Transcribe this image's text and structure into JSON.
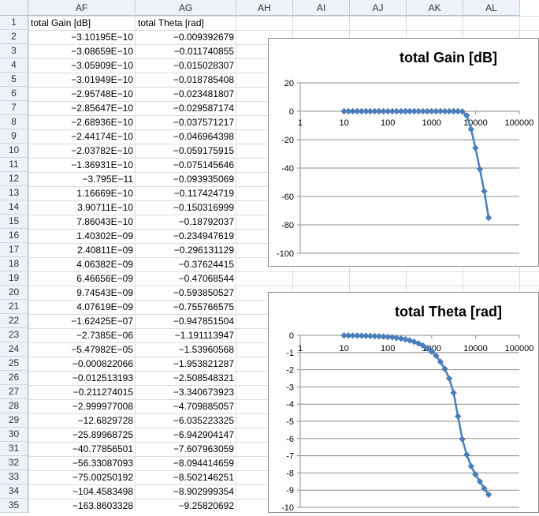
{
  "columns": [
    "AF",
    "AG",
    "AH",
    "AI",
    "AJ",
    "AK",
    "AL"
  ],
  "rows": [
    {
      "n": "1",
      "af": "total Gain [dB]",
      "ag": "total Theta [rad]"
    },
    {
      "n": "2",
      "af": "−3.10195E−10",
      "ag": "−0.009392679"
    },
    {
      "n": "3",
      "af": "−3.08659E−10",
      "ag": "−0.011740855"
    },
    {
      "n": "4",
      "af": "−3.05909E−10",
      "ag": "−0.015028307"
    },
    {
      "n": "5",
      "af": "−3.01949E−10",
      "ag": "−0.018785408"
    },
    {
      "n": "6",
      "af": "−2.95748E−10",
      "ag": "−0.023481807"
    },
    {
      "n": "7",
      "af": "−2.85647E−10",
      "ag": "−0.029587174"
    },
    {
      "n": "8",
      "af": "−2.68936E−10",
      "ag": "−0.037571217"
    },
    {
      "n": "9",
      "af": "−2.44174E−10",
      "ag": "−0.046964398"
    },
    {
      "n": "10",
      "af": "−2.03782E−10",
      "ag": "−0.059175915"
    },
    {
      "n": "11",
      "af": "−1.36931E−10",
      "ag": "−0.075145646"
    },
    {
      "n": "12",
      "af": "−3.795E−11",
      "ag": "−0.093935069"
    },
    {
      "n": "13",
      "af": "1.16669E−10",
      "ag": "−0.117424719"
    },
    {
      "n": "14",
      "af": "3.90711E−10",
      "ag": "−0.150316999"
    },
    {
      "n": "15",
      "af": "7.86043E−10",
      "ag": "−0.18792037"
    },
    {
      "n": "16",
      "af": "1.40302E−09",
      "ag": "−0.234947619"
    },
    {
      "n": "17",
      "af": "2.40811E−09",
      "ag": "−0.296131129"
    },
    {
      "n": "18",
      "af": "4.06382E−09",
      "ag": "−0.37624415"
    },
    {
      "n": "19",
      "af": "6.46656E−09",
      "ag": "−0.47068544"
    },
    {
      "n": "20",
      "af": "9.74543E−09",
      "ag": "−0.593850527"
    },
    {
      "n": "21",
      "af": "4.07619E−09",
      "ag": "−0.755766575"
    },
    {
      "n": "22",
      "af": "−1.62425E−07",
      "ag": "−0.947851504"
    },
    {
      "n": "23",
      "af": "−2.7385E−06",
      "ag": "−1.191113947"
    },
    {
      "n": "24",
      "af": "−5.47982E−05",
      "ag": "−1.53960568"
    },
    {
      "n": "25",
      "af": "−0.000822066",
      "ag": "−1.953821287"
    },
    {
      "n": "26",
      "af": "−0.012513193",
      "ag": "−2.508548321"
    },
    {
      "n": "27",
      "af": "−0.211274015",
      "ag": "−3.340673923"
    },
    {
      "n": "28",
      "af": "−2.999977008",
      "ag": "−4.709885057"
    },
    {
      "n": "29",
      "af": "−12.6829728",
      "ag": "−6.035223325"
    },
    {
      "n": "30",
      "af": "−25.89968725",
      "ag": "−6.942904147"
    },
    {
      "n": "31",
      "af": "−40.77856501",
      "ag": "−7.607963059"
    },
    {
      "n": "32",
      "af": "−56.33087093",
      "ag": "−8.094414659"
    },
    {
      "n": "33",
      "af": "−75.00250192",
      "ag": "−8.502146251"
    },
    {
      "n": "34",
      "af": "−104.4583498",
      "ag": "−8.902999354"
    },
    {
      "n": "35",
      "af": "−163.8603328",
      "ag": "−9.25820692"
    }
  ],
  "chart_data": [
    {
      "type": "line",
      "title": "total Gain [dB]",
      "xscale": "log",
      "xlim": [
        1,
        100000
      ],
      "xticks": [
        "1",
        "10",
        "100",
        "1000",
        "10000",
        "100000"
      ],
      "ylim": [
        -100,
        20
      ],
      "yticks": [
        "20",
        "0",
        "-20",
        "-40",
        "-60",
        "-80",
        "-100"
      ],
      "grid": "horizontal",
      "color": "#4a7ebb",
      "x": [
        10,
        12.6,
        15.8,
        20,
        25.1,
        31.6,
        39.8,
        50.1,
        63.1,
        79.4,
        100,
        126,
        158,
        200,
        251,
        316,
        398,
        501,
        631,
        794,
        1000,
        1259,
        1585,
        1995,
        2512,
        3162,
        3981,
        5012,
        6310,
        7943,
        10000,
        12589,
        15849,
        19953
      ],
      "y": [
        0,
        0,
        0,
        0,
        0,
        0,
        0,
        0,
        0,
        0,
        0,
        0,
        0,
        0,
        0,
        0,
        0,
        0,
        0,
        0,
        0,
        0,
        0,
        0,
        0,
        0,
        0,
        -0.21,
        -3.0,
        -12.68,
        -25.9,
        -40.78,
        -56.33,
        -75.0
      ]
    },
    {
      "type": "line",
      "title": "total Theta [rad]",
      "xscale": "log",
      "xlim": [
        1,
        100000
      ],
      "xticks": [
        "1",
        "10",
        "100",
        "1000",
        "10000",
        "100000"
      ],
      "ylim": [
        -10,
        0
      ],
      "yticks": [
        "0",
        "-1",
        "-2",
        "-3",
        "-4",
        "-5",
        "-6",
        "-7",
        "-8",
        "-9",
        "-10"
      ],
      "grid": "horizontal",
      "color": "#4a7ebb",
      "x": [
        10,
        12.6,
        15.8,
        20,
        25.1,
        31.6,
        39.8,
        50.1,
        63.1,
        79.4,
        100,
        126,
        158,
        200,
        251,
        316,
        398,
        501,
        631,
        794,
        1000,
        1259,
        1585,
        1995,
        2512,
        3162,
        3981,
        5012,
        6310,
        7943,
        10000,
        12589,
        15849,
        19953
      ],
      "y": [
        -0.009,
        -0.012,
        -0.015,
        -0.019,
        -0.023,
        -0.03,
        -0.038,
        -0.047,
        -0.059,
        -0.075,
        -0.094,
        -0.117,
        -0.15,
        -0.188,
        -0.235,
        -0.296,
        -0.376,
        -0.471,
        -0.594,
        -0.756,
        -0.948,
        -1.19,
        -1.54,
        -1.95,
        -2.51,
        -3.34,
        -4.71,
        -6.04,
        -6.94,
        -7.61,
        -8.09,
        -8.5,
        -8.9,
        -9.26
      ]
    }
  ]
}
